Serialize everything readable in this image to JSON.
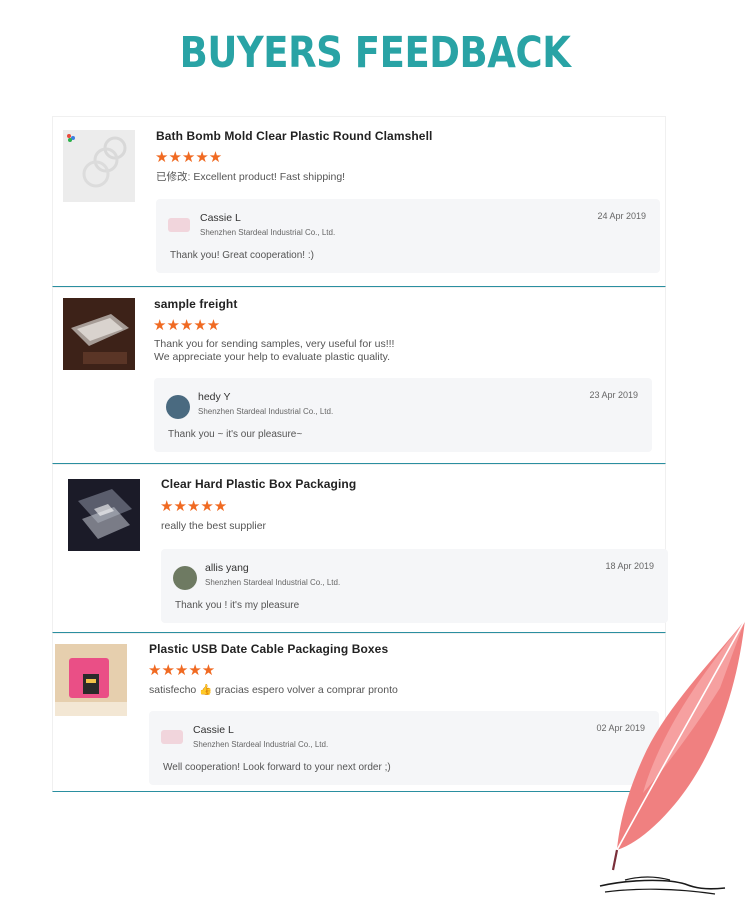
{
  "header": {
    "title": "BUYERS FEEDBACK"
  },
  "colors": {
    "title": "#29a3a5",
    "stars": "#f06a22",
    "divider": "#2a8fa0",
    "reply_bg": "#f5f6f8"
  },
  "reviews": [
    {
      "product": "Bath Bomb Mold Clear Plastic Round Clamshell",
      "rating": 5,
      "stars": "★★★★★",
      "text": [
        "已修改: Excellent product! Fast shipping!"
      ],
      "reply": {
        "name": "Cassie L",
        "company": "Shenzhen Stardeal Industrial Co., Ltd.",
        "date": "24 Apr 2019",
        "text": "Thank you! Great cooperation! :)"
      }
    },
    {
      "product": "sample freight",
      "rating": 5,
      "stars": "★★★★★",
      "text": [
        "Thank you for sending samples, very useful for us!!!",
        "We appreciate your help to evaluate plastic quality."
      ],
      "reply": {
        "name": "hedy Y",
        "company": "Shenzhen Stardeal Industrial Co., Ltd.",
        "date": "23 Apr 2019",
        "text": "Thank you ~ it's our pleasure~"
      }
    },
    {
      "product": "Clear Hard Plastic Box Packaging",
      "rating": 5,
      "stars": "★★★★★",
      "text": [
        "really the best supplier"
      ],
      "reply": {
        "name": "allis yang",
        "company": "Shenzhen Stardeal Industrial Co., Ltd.",
        "date": "18 Apr 2019",
        "text": "Thank you !  it's my pleasure"
      }
    },
    {
      "product": "Plastic USB Date Cable Packaging Boxes",
      "rating": 5,
      "stars": "★★★★★",
      "text": [
        "satisfecho 👍 gracias espero volver a comprar pronto"
      ],
      "reply": {
        "name": "Cassie L",
        "company": "Shenzhen Stardeal Industrial Co., Ltd.",
        "date": "02 Apr 2019",
        "text": "Well cooperation! Look forward to your next order ;)"
      }
    }
  ]
}
